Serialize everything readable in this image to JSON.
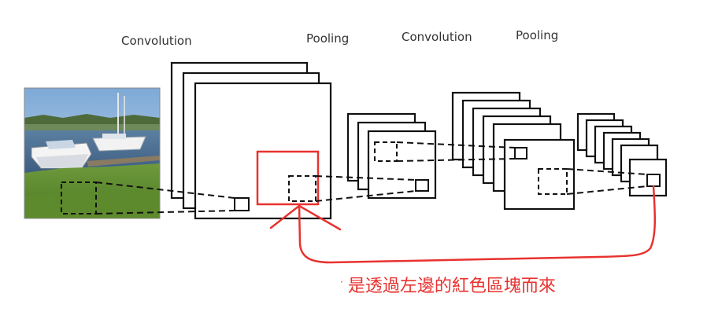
{
  "labels": {
    "convolution_1": "Convolution",
    "pooling_1": "Pooling",
    "convolution_2": "Convolution",
    "pooling_2": "Pooling"
  },
  "annotation": {
    "bullet": "·",
    "text": "是透過左邊的紅色區塊而來"
  },
  "colors": {
    "annotation": "#e8322f",
    "stroke": "#111111",
    "label": "#333333"
  },
  "icons": {
    "input_photo": "harbor-boats-photo"
  }
}
